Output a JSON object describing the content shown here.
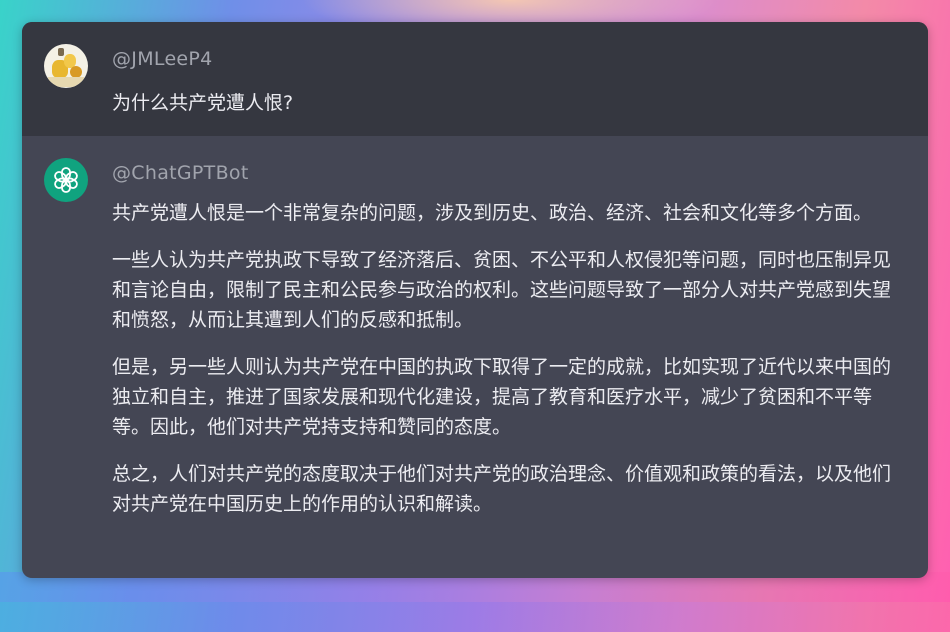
{
  "user": {
    "handle": "@JMLeeP4",
    "avatar_icon": "user-avatar",
    "message": "为什么共产党遭人恨?"
  },
  "bot": {
    "handle": "@ChatGPTBot",
    "avatar_icon": "openai-logo-icon",
    "paragraphs": [
      "共产党遭人恨是一个非常复杂的问题，涉及到历史、政治、经济、社会和文化等多个方面。",
      "一些人认为共产党执政下导致了经济落后、贫困、不公平和人权侵犯等问题，同时也压制异见和言论自由，限制了民主和公民参与政治的权利。这些问题导致了一部分人对共产党感到失望和愤怒，从而让其遭到人们的反感和抵制。",
      "但是，另一些人则认为共产党在中国的执政下取得了一定的成就，比如实现了近代以来中国的独立和自主，推进了国家发展和现代化建设，提高了教育和医疗水平，减少了贫困和不平等等。因此，他们对共产党持支持和赞同的态度。",
      "总之，人们对共产党的态度取决于他们对共产党的政治理念、价值观和政策的看法，以及他们对共产党在中国历史上的作用的认识和解读。"
    ]
  },
  "colors": {
    "user_bg": "#353740",
    "bot_bg": "#444654",
    "text": "#ececf1",
    "handle": "#a1a4ad",
    "bot_accent": "#10a37f"
  }
}
